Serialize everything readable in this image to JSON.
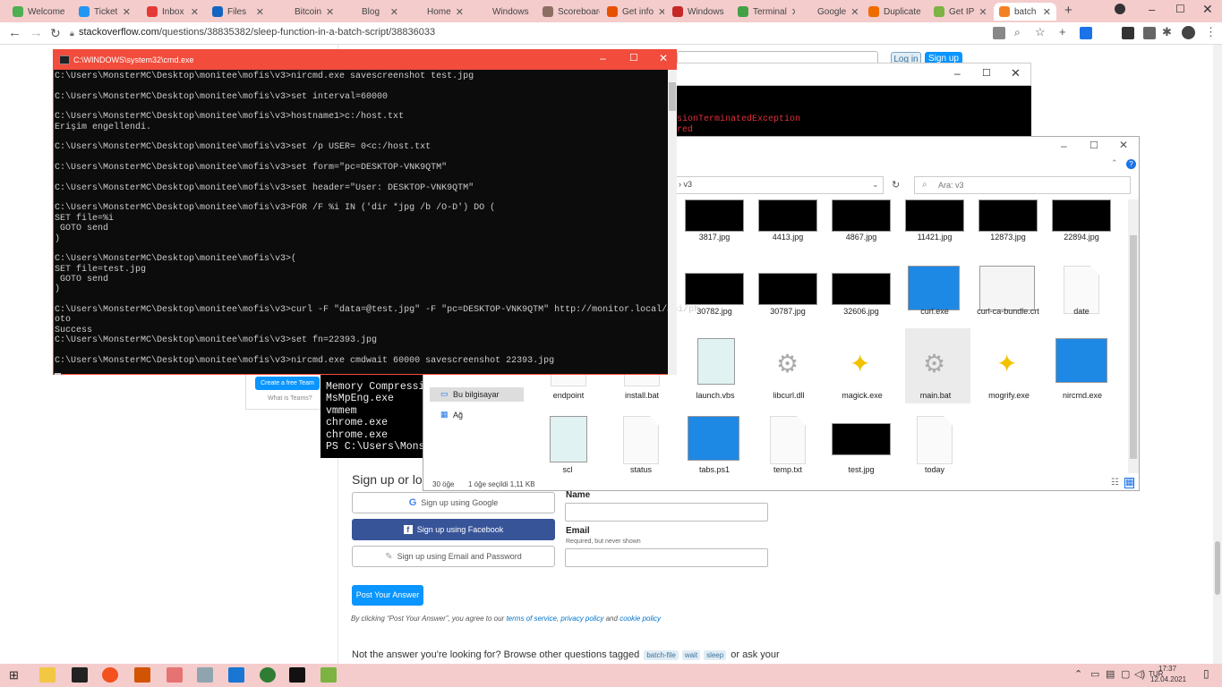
{
  "browser": {
    "tabs": [
      {
        "label": "Welcome",
        "color": "#4caf50"
      },
      {
        "label": "Ticket",
        "color": "#2196f3"
      },
      {
        "label": "Inbox",
        "color": "#e53935"
      },
      {
        "label": "Files",
        "color": "#1565c0"
      },
      {
        "label": "Bitcoin",
        "color": "#f4cccc"
      },
      {
        "label": "Blog",
        "color": "#f4cccc"
      },
      {
        "label": "Home",
        "color": "#f4cccc"
      },
      {
        "label": "Windows",
        "color": "#f4cccc"
      },
      {
        "label": "Scoreboard",
        "color": "#8d6e63"
      },
      {
        "label": "Get info",
        "color": "#e65100"
      },
      {
        "label": "Windows",
        "color": "#c62828"
      },
      {
        "label": "Terminal",
        "color": "#43a047"
      },
      {
        "label": "Google",
        "color": "#f4cccc"
      },
      {
        "label": "Duplicate",
        "color": "#ef6c00"
      },
      {
        "label": "Get IP",
        "color": "#7cb342"
      },
      {
        "label": "batch",
        "color": "#f48024"
      }
    ],
    "url_domain": "stackoverflow.com",
    "url_path": "/questions/38835382/sleep-function-in-a-batch-script/38836033"
  },
  "page": {
    "login_label": "Log in",
    "signup_label": "Sign up",
    "create_team_label": "Create a free Team",
    "what_is_teams": "What is Teams?",
    "signup_heading": "Sign up or log in",
    "google_btn": "Sign up using Google",
    "facebook_btn": "Sign up using Facebook",
    "email_btn": "Sign up using Email and Password",
    "name_label": "Name",
    "email_label": "Email",
    "email_hint": "Required, but never shown",
    "post_btn": "Post Your Answer",
    "terms_prefix": "By clicking “Post Your Answer”, you agree to our",
    "terms_link": "terms of service",
    "privacy_link": "privacy policy",
    "and": "and",
    "cookie_link": "cookie policy",
    "footer_prefix": "Not the answer you're looking for? Browse other questions tagged",
    "tags": [
      "batch-file",
      "wait",
      "sleep"
    ],
    "footer_suffix": "or ask your"
  },
  "cmd": {
    "title": "C:\\WINDOWS\\system32\\cmd.exe",
    "lines": [
      "C:\\Users\\MonsterMC\\Desktop\\monitee\\mofis\\v3>nircmd.exe savescreenshot test.jpg",
      "",
      "C:\\Users\\MonsterMC\\Desktop\\monitee\\mofis\\v3>set interval=60000",
      "",
      "C:\\Users\\MonsterMC\\Desktop\\monitee\\mofis\\v3>hostname1>c:/host.txt",
      "Erişim engellendi.",
      "",
      "C:\\Users\\MonsterMC\\Desktop\\monitee\\mofis\\v3>set /p USER= 0<c:/host.txt",
      "",
      "C:\\Users\\MonsterMC\\Desktop\\monitee\\mofis\\v3>set form=\"pc=DESKTOP-VNK9QTM\"",
      "",
      "C:\\Users\\MonsterMC\\Desktop\\monitee\\mofis\\v3>set header=\"User: DESKTOP-VNK9QTM\"",
      "",
      "C:\\Users\\MonsterMC\\Desktop\\monitee\\mofis\\v3>FOR /F %i IN ('dir *jpg /b /O-D') DO (",
      "SET file=%i",
      " GOTO send",
      ")",
      "",
      "C:\\Users\\MonsterMC\\Desktop\\monitee\\mofis\\v3>(",
      "SET file=test.jpg",
      " GOTO send",
      ")",
      "",
      "C:\\Users\\MonsterMC\\Desktop\\monitee\\mofis\\v3>curl -F \"data=@test.jpg\" -F \"pc=DESKTOP-VNK9QTM\" http://monitor.local/api/ph",
      "oto",
      "Success",
      "C:\\Users\\MonsterMC\\Desktop\\monitee\\mofis\\v3>set fn=22393.jpg",
      "",
      "C:\\Users\\MonsterMC\\Desktop\\monitee\\mofis\\v3>nircmd.exe cmdwait 60000 savescreenshot 22393.jpg"
    ]
  },
  "ps": {
    "red_line1": "sionTerminatedException",
    "red_line2": "red",
    "lines": [
      "Memory Compressio",
      "MsMpEng.exe",
      "vmmem",
      "chrome.exe",
      "chrome.exe",
      "PS C:\\Users\\Monst"
    ]
  },
  "explorer": {
    "path_segment": "v3",
    "search_placeholder": "Ara: v3",
    "nav_this_pc": "Bu bilgisayar",
    "nav_network": "Ağ",
    "status_count": "30 öğe",
    "status_selected": "1 öğe seçildi  1,11 KB",
    "row1": [
      "3817.jpg",
      "4413.jpg",
      "4867.jpg",
      "11421.jpg",
      "12873.jpg",
      "22894.jpg"
    ],
    "row2": [
      "30782.jpg",
      "30787.jpg",
      "32606.jpg",
      "curl.exe",
      "curl-ca-bundle.crt",
      "date"
    ],
    "row3": [
      "endpoint",
      "install.bat",
      "launch.vbs",
      "libcurl.dll",
      "magick.exe",
      "main.bat",
      "mogrify.exe",
      "nircmd.exe"
    ],
    "row4": [
      "scl",
      "status",
      "tabs.ps1",
      "temp.txt",
      "test.jpg",
      "today"
    ]
  },
  "taskbar": {
    "time": "17:37",
    "date": "12.04.2021",
    "lang": "TUR"
  },
  "colors": {
    "accent_pink": "#f4cccc",
    "cmd_title": "#f14c3c",
    "so_blue": "#0a95ff",
    "fb_blue": "#385499"
  }
}
